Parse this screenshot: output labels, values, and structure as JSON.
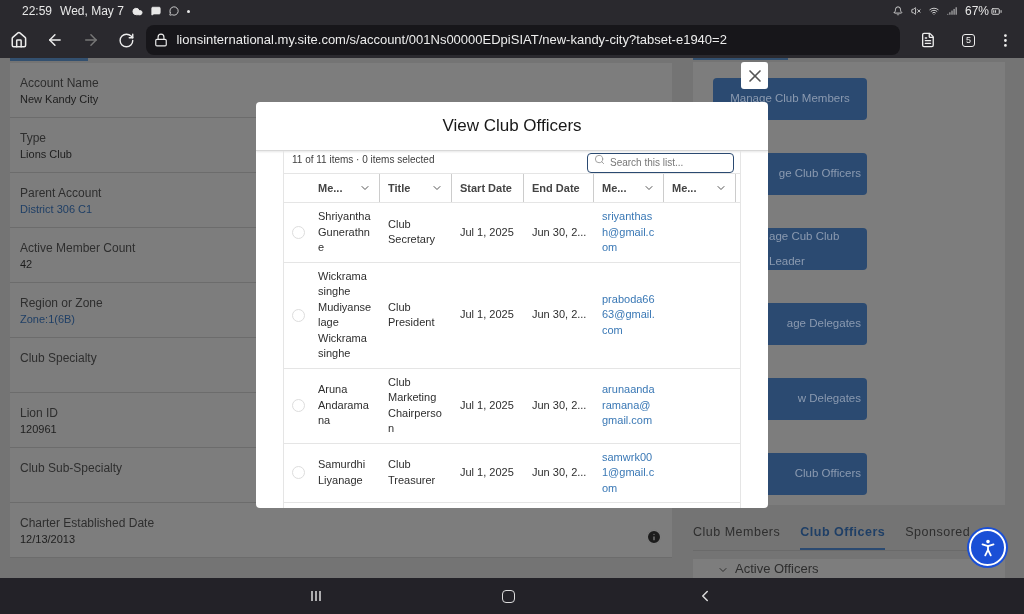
{
  "status_bar": {
    "time": "22:59",
    "date": "Wed, May 7",
    "battery": "67%"
  },
  "browser": {
    "url": "lionsinternational.my.site.com/s/account/001Ns00000EDpiSIAT/new-kandy-city?tabset-e1940=2",
    "tab_count": "5"
  },
  "record": {
    "fields": [
      {
        "label": "Account Name",
        "value": "New Kandy City",
        "kind": "text"
      },
      {
        "label": "Type",
        "value": "Lions Club",
        "kind": "text"
      },
      {
        "label": "Parent Account",
        "value": "District 306 C1",
        "kind": "link"
      },
      {
        "label": "Active Member Count",
        "value": "42",
        "kind": "text"
      },
      {
        "label": "Region or Zone",
        "value": "Zone:1(6B)",
        "kind": "link"
      },
      {
        "label": "Club Specialty"
      },
      {
        "label": "Lion ID",
        "value": "120961",
        "kind": "text"
      },
      {
        "label": "Club Sub-Specialty"
      },
      {
        "label": "Charter Established Date",
        "value": "12/13/2013",
        "kind": "text",
        "info": true
      }
    ]
  },
  "actions": [
    "Manage Club Members",
    "ge Club Officers",
    "age Cub Club Leader",
    "age Delegates",
    "w Delegates",
    "Club Officers"
  ],
  "tabs": [
    {
      "label": "Club Members",
      "selected": false
    },
    {
      "label": "Club Officers",
      "selected": true
    },
    {
      "label": "Sponsored",
      "selected": false
    }
  ],
  "section": {
    "title": "Active Officers",
    "expanded": true
  },
  "modal": {
    "title": "View Club Officers",
    "summary": "11 of 11 items · 0 items selected",
    "search": {
      "placeholder": "Search this list..."
    },
    "columns": [
      {
        "label": "Me...",
        "menu": true
      },
      {
        "label": "Title",
        "menu": true
      },
      {
        "label": "Start Date",
        "menu": false
      },
      {
        "label": "End Date",
        "menu": false
      },
      {
        "label": "Me...",
        "menu": true
      },
      {
        "label": "Me...",
        "menu": true
      }
    ],
    "rows": [
      {
        "name": "Shriyantha Gunerathne",
        "title": "Club Secretary",
        "start": "Jul 1, 2025",
        "end": "Jun 30, 2...",
        "email": "sriyanthash@gmail.com",
        "selected": false
      },
      {
        "name": "Wickramasinghe Mudiyanselage Wickramasinghe",
        "title": "Club President",
        "start": "Jul 1, 2025",
        "end": "Jun 30, 2...",
        "email": "praboda6663@gmail.com",
        "selected": false
      },
      {
        "name": "Aruna Andaramana",
        "title": "Club Marketing Chairperson",
        "start": "Jul 1, 2025",
        "end": "Jun 30, 2...",
        "email": "arunaandaramana@gmail.com",
        "selected": false
      },
      {
        "name": "Samurdhi Liyanage",
        "title": "Club Treasurer",
        "start": "Jul 1, 2025",
        "end": "Jun 30, 2...",
        "email": "samwrk001@gmail.com",
        "selected": false
      }
    ]
  }
}
